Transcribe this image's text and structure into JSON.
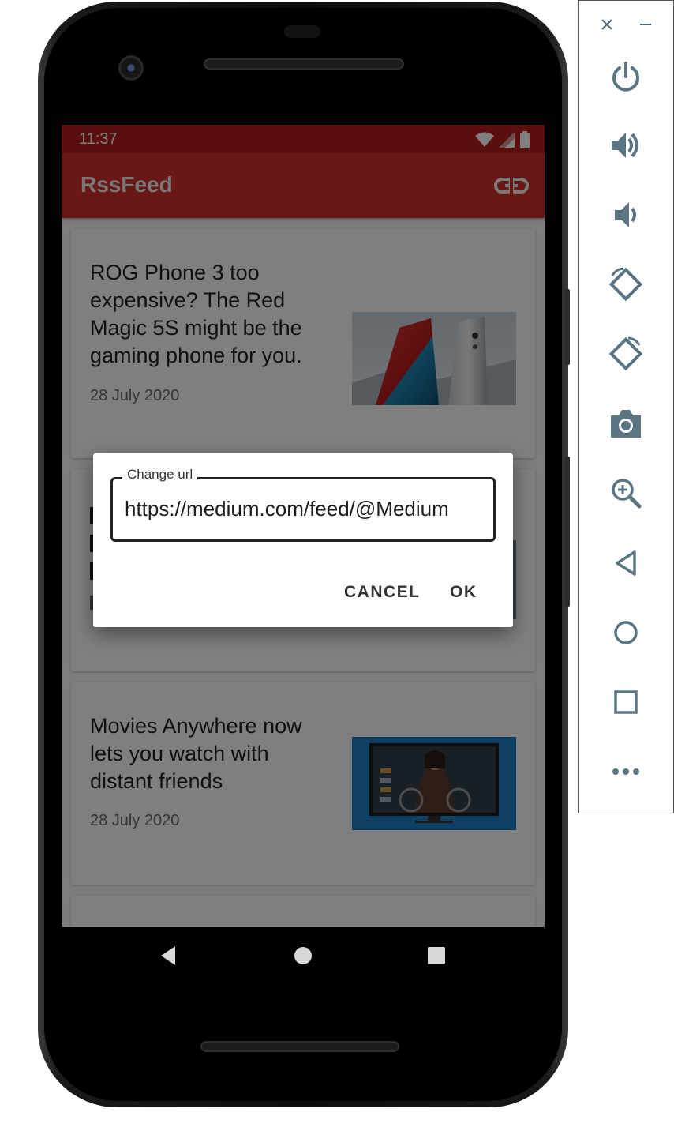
{
  "status_bar": {
    "time": "11:37"
  },
  "app_bar": {
    "title": "RssFeed",
    "action_icon": "link-icon"
  },
  "feed": {
    "items": [
      {
        "title": "ROG Phone 3 too expensive? The Red Magic 5S might be the gaming phone for you.",
        "date": "28 July 2020",
        "thumb": "red-magic-phones-image"
      },
      {
        "title": "",
        "date": "",
        "thumb": "hidden-article-image"
      },
      {
        "title": "Movies Anywhere now lets you watch with distant friends",
        "date": "28 July 2020",
        "thumb": "movie-on-tv-image"
      }
    ]
  },
  "dialog": {
    "field_label": "Change url",
    "field_value": "https://medium.com/feed/@Medium",
    "cancel_label": "CANCEL",
    "ok_label": "OK"
  },
  "nav_bar": {
    "icons": [
      "back-icon",
      "home-icon",
      "recents-icon"
    ]
  },
  "emulator_toolbar": {
    "icons": [
      "close-icon",
      "minimize-icon",
      "power-icon",
      "volume-up-icon",
      "volume-down-icon",
      "rotate-left-icon",
      "rotate-right-icon",
      "camera-icon",
      "zoom-icon",
      "back-icon",
      "home-icon",
      "overview-icon",
      "more-icon"
    ]
  },
  "colors": {
    "app_bar": "#d32f2f",
    "status_bar": "#b71c1c",
    "toolbar_icon": "#5b7583"
  }
}
